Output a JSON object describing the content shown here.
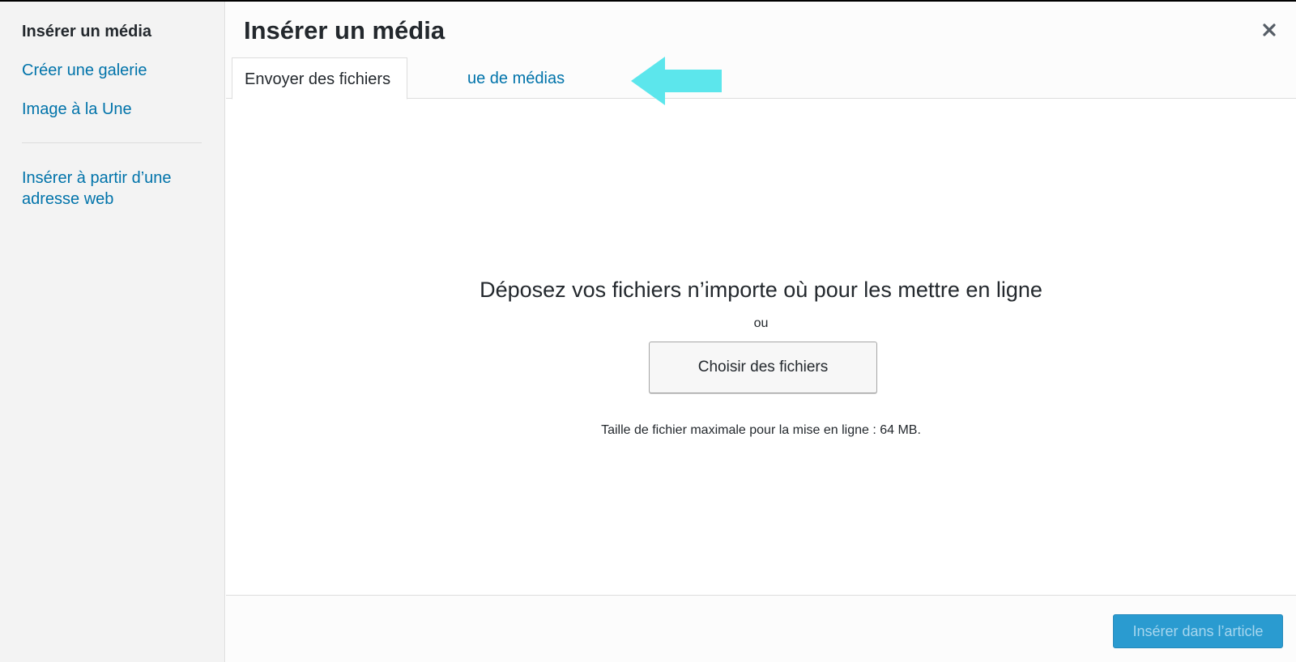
{
  "sidebar": {
    "title": "Insérer un média",
    "links": [
      {
        "label": "Créer une galerie"
      },
      {
        "label": "Image à la Une"
      },
      {
        "label": "Insérer à partir d’une adresse web"
      }
    ]
  },
  "header": {
    "title": "Insérer un média",
    "close_icon": "close-icon"
  },
  "tabs": [
    {
      "label": "Envoyer des fichiers",
      "active": true
    },
    {
      "label": "Bibliothèque de médias",
      "visible_label": "ue de médias",
      "active": false
    }
  ],
  "annotation": {
    "type": "arrow",
    "color": "#5ce6ec"
  },
  "upload": {
    "instruction": "Déposez vos fichiers n’importe où pour les mettre en ligne",
    "or": "ou",
    "choose_button": "Choisir des fichiers",
    "max_size": "Taille de fichier maximale pour la mise en ligne : 64 MB."
  },
  "footer": {
    "insert_button": "Insérer dans l’article",
    "insert_disabled": true
  },
  "colors": {
    "link": "#0073aa",
    "primary_button": "#2a9bd0",
    "sidebar_bg": "#f3f3f3"
  }
}
